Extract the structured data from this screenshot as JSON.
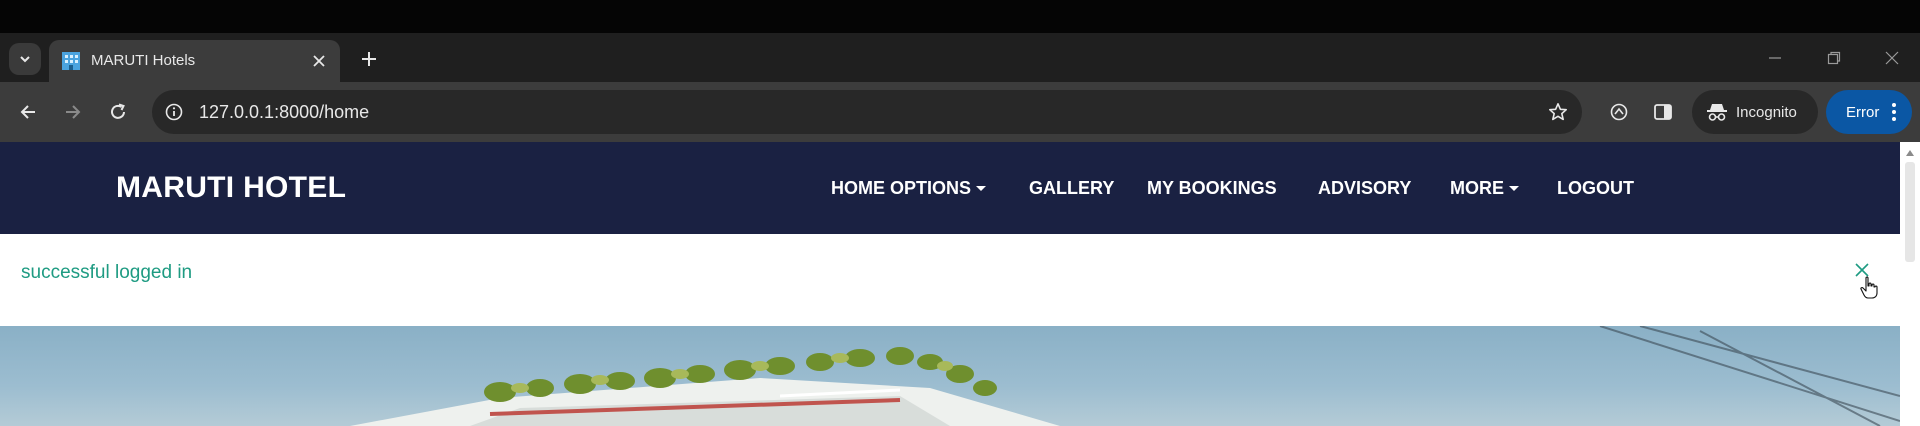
{
  "browser": {
    "tab": {
      "title": "MARUTI Hotels"
    },
    "address": {
      "url": "127.0.0.1:8000/home"
    },
    "incognito_label": "Incognito",
    "error_label": "Error"
  },
  "site": {
    "brand": "MARUTI HOTEL",
    "nav": {
      "home_options": "HOME OPTIONS",
      "gallery": "GALLERY",
      "my_bookings": "MY BOOKINGS",
      "advisory": "ADVISORY",
      "more": "MORE",
      "logout": "LOGOUT"
    },
    "alert": {
      "message": "successful logged in"
    }
  },
  "colors": {
    "navbar": "#1a2142",
    "alert_text": "#1e9b82",
    "error_button": "#0b57a4",
    "toolbar": "#3c3c3c",
    "tabstrip": "#1f1f1f"
  },
  "icons": [
    "tab-search-icon",
    "hotel-favicon-icon",
    "close-icon",
    "plus-icon",
    "minimize-icon",
    "restore-icon",
    "back-arrow-icon",
    "forward-arrow-icon",
    "reload-icon",
    "site-info-icon",
    "star-icon",
    "extension-icon",
    "side-panel-icon",
    "incognito-icon",
    "kebab-menu-icon",
    "cursor-hand-icon"
  ]
}
